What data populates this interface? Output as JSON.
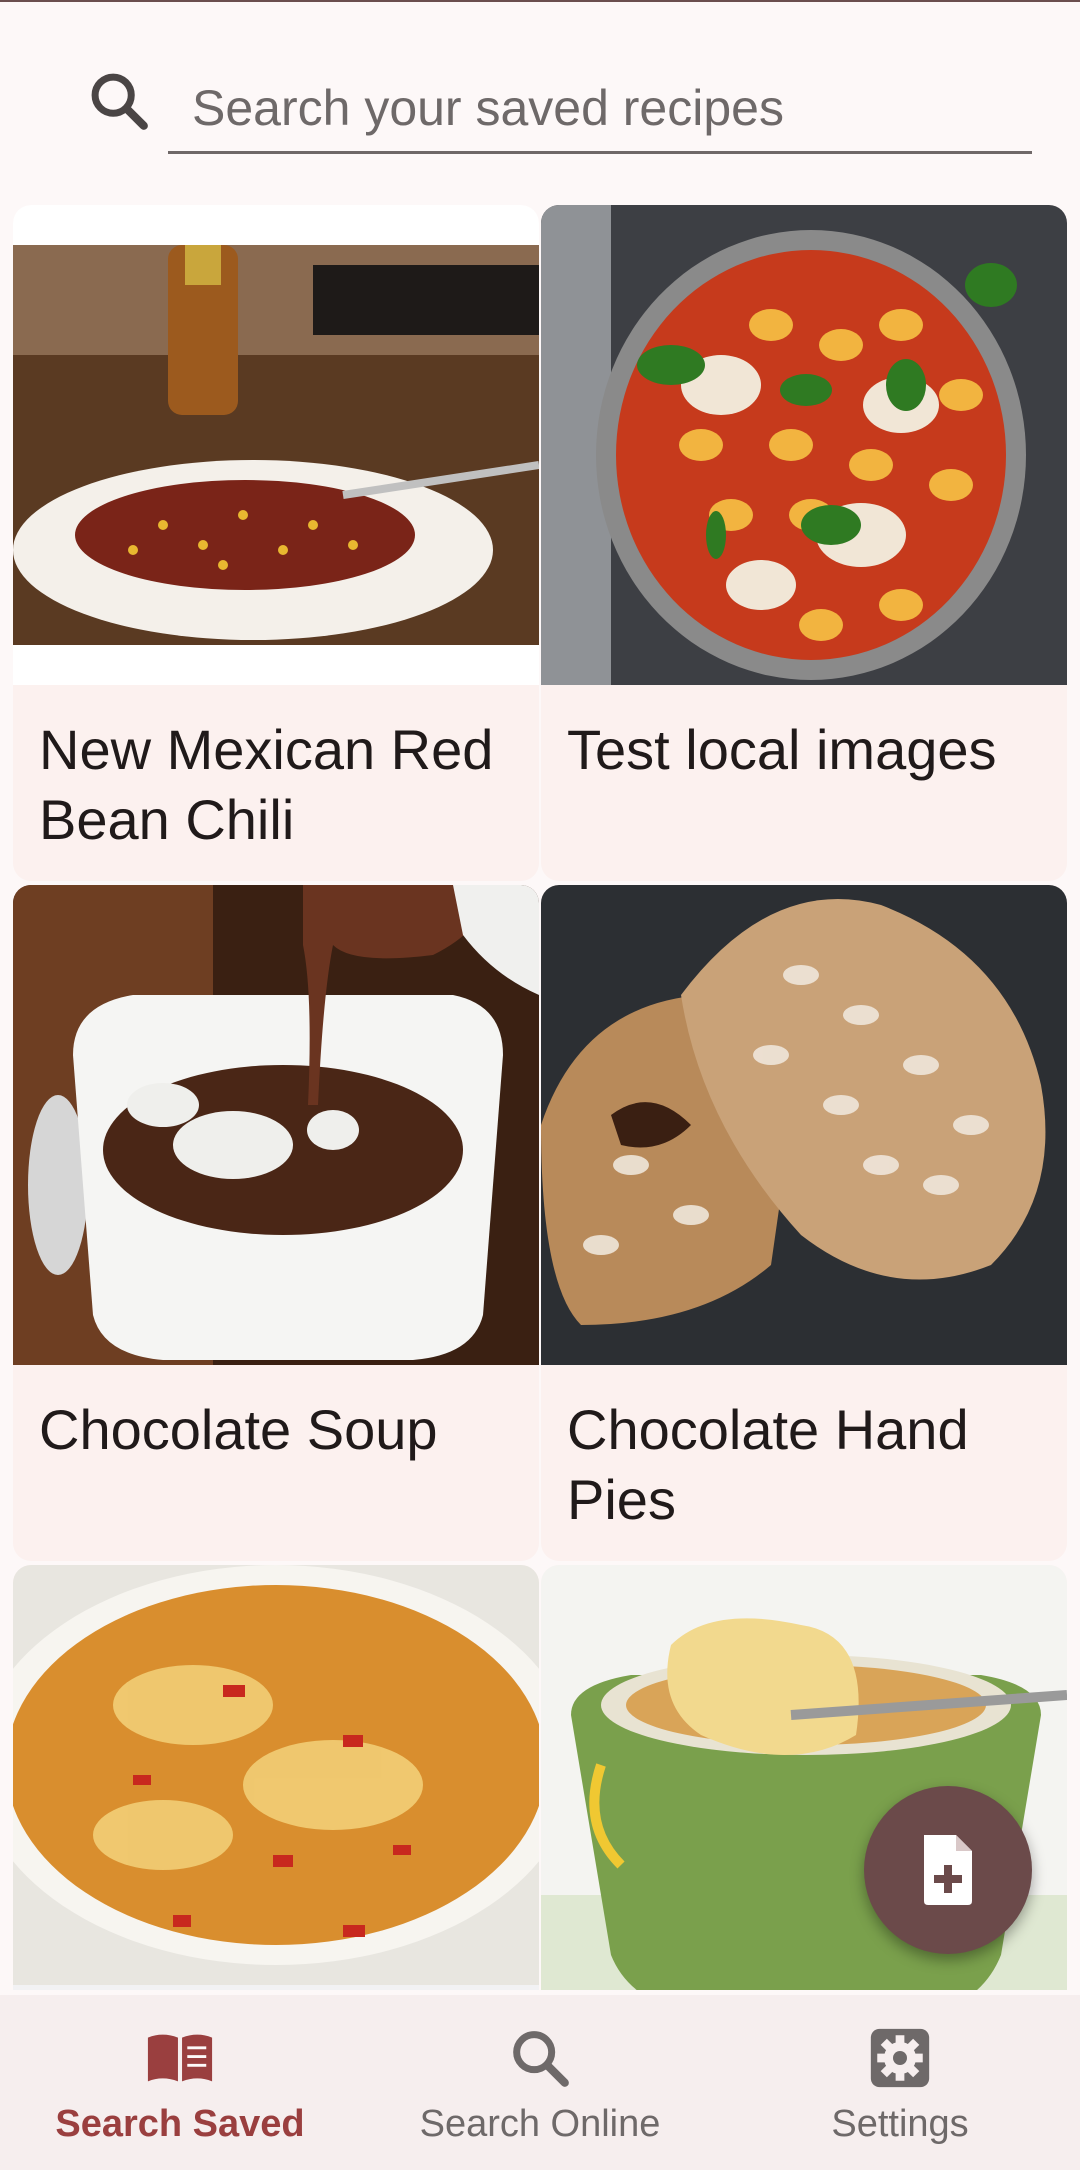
{
  "search": {
    "placeholder": "Search your saved recipes"
  },
  "recipes": [
    {
      "title": "New Mexican Red Bean Chili"
    },
    {
      "title": "Test local images"
    },
    {
      "title": "Chocolate Soup"
    },
    {
      "title": "Chocolate Hand Pies"
    },
    {
      "title": ""
    },
    {
      "title": ""
    }
  ],
  "fab": {
    "icon": "note-add-icon"
  },
  "bottom_nav": {
    "items": [
      {
        "label": "Search Saved",
        "icon": "book-icon",
        "active": true
      },
      {
        "label": "Search Online",
        "icon": "search-icon",
        "active": false
      },
      {
        "label": "Settings",
        "icon": "gear-icon",
        "active": false
      }
    ]
  },
  "colors": {
    "accent": "#9a3f3f",
    "fab": "#6b4a4a",
    "card": "#fcf1ef",
    "nav_bg": "#f6eeee"
  }
}
